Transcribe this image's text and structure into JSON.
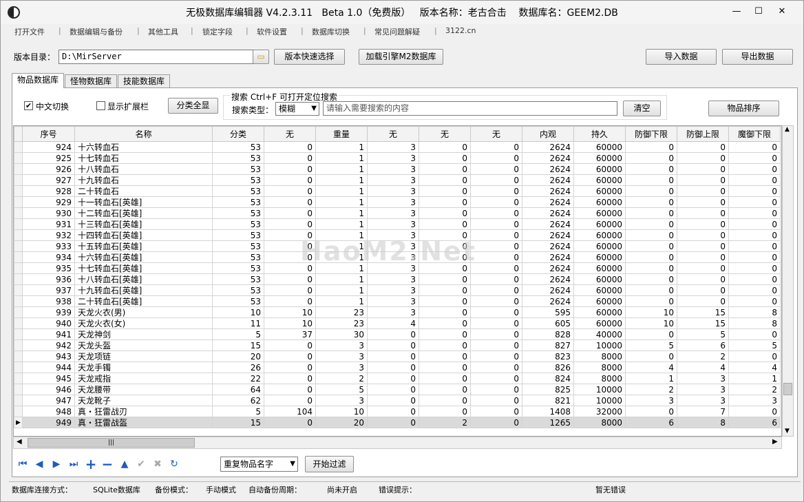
{
  "window": {
    "title": "无极数据库编辑器 V4.2.3.11   Beta 1.0（免费版）   版本名称：老古合击    数据库名：GEEM2.DB",
    "minimize": "—",
    "maximize": "☐",
    "close": "✕"
  },
  "menu": [
    "打开文件",
    "数据编辑与备份",
    "其他工具",
    "锁定字段",
    "软件设置",
    "数据库切换",
    "常见问题解疑",
    "3122.cn"
  ],
  "top": {
    "dir_label": "版本目录：",
    "dir_value": "D:\\MirServer",
    "quick_select": "版本快速选择",
    "load_engine": "加载引擎M2数据库",
    "import": "导入数据",
    "export": "导出数据"
  },
  "tabs": [
    "物品数据库",
    "怪物数据库",
    "技能数据库"
  ],
  "filters": {
    "chinese_switch": "中文切换",
    "chinese_checked": "✔",
    "show_ext": "显示扩展栏",
    "show_all": "分类全显",
    "search_title": "搜索  Ctrl+F 可打开定位搜索",
    "search_type_label": "搜索类型：",
    "search_type_value": "模糊",
    "search_placeholder": "请输入需要搜索的内容",
    "clear": "清空",
    "sort_items": "物品排序"
  },
  "grid": {
    "columns": [
      "序号",
      "名称",
      "分类",
      "无",
      "重量",
      "无",
      "无",
      "无",
      "内观",
      "持久",
      "防御下限",
      "防御上限",
      "魔御下限"
    ],
    "rows": [
      [
        "924",
        "十六转血石",
        "53",
        "0",
        "1",
        "3",
        "0",
        "0",
        "2624",
        "60000",
        "0",
        "0",
        "0"
      ],
      [
        "925",
        "十七转血石",
        "53",
        "0",
        "1",
        "3",
        "0",
        "0",
        "2624",
        "60000",
        "0",
        "0",
        "0"
      ],
      [
        "926",
        "十八转血石",
        "53",
        "0",
        "1",
        "3",
        "0",
        "0",
        "2624",
        "60000",
        "0",
        "0",
        "0"
      ],
      [
        "927",
        "十九转血石",
        "53",
        "0",
        "1",
        "3",
        "0",
        "0",
        "2624",
        "60000",
        "0",
        "0",
        "0"
      ],
      [
        "928",
        "二十转血石",
        "53",
        "0",
        "1",
        "3",
        "0",
        "0",
        "2624",
        "60000",
        "0",
        "0",
        "0"
      ],
      [
        "929",
        "十一转血石[英雄]",
        "53",
        "0",
        "1",
        "3",
        "0",
        "0",
        "2624",
        "60000",
        "0",
        "0",
        "0"
      ],
      [
        "930",
        "十二转血石[英雄]",
        "53",
        "0",
        "1",
        "3",
        "0",
        "0",
        "2624",
        "60000",
        "0",
        "0",
        "0"
      ],
      [
        "931",
        "十三转血石[英雄]",
        "53",
        "0",
        "1",
        "3",
        "0",
        "0",
        "2624",
        "60000",
        "0",
        "0",
        "0"
      ],
      [
        "932",
        "十四转血石[英雄]",
        "53",
        "0",
        "1",
        "3",
        "0",
        "0",
        "2624",
        "60000",
        "0",
        "0",
        "0"
      ],
      [
        "933",
        "十五转血石[英雄]",
        "53",
        "0",
        "1",
        "3",
        "0",
        "0",
        "2624",
        "60000",
        "0",
        "0",
        "0"
      ],
      [
        "934",
        "十六转血石[英雄]",
        "53",
        "0",
        "1",
        "3",
        "0",
        "0",
        "2624",
        "60000",
        "0",
        "0",
        "0"
      ],
      [
        "935",
        "十七转血石[英雄]",
        "53",
        "0",
        "1",
        "3",
        "0",
        "0",
        "2624",
        "60000",
        "0",
        "0",
        "0"
      ],
      [
        "936",
        "十八转血石[英雄]",
        "53",
        "0",
        "1",
        "3",
        "0",
        "0",
        "2624",
        "60000",
        "0",
        "0",
        "0"
      ],
      [
        "937",
        "十九转血石[英雄]",
        "53",
        "0",
        "1",
        "3",
        "0",
        "0",
        "2624",
        "60000",
        "0",
        "0",
        "0"
      ],
      [
        "938",
        "二十转血石[英雄]",
        "53",
        "0",
        "1",
        "3",
        "0",
        "0",
        "2624",
        "60000",
        "0",
        "0",
        "0"
      ],
      [
        "939",
        "天龙火衣(男)",
        "10",
        "10",
        "23",
        "3",
        "0",
        "0",
        "595",
        "60000",
        "10",
        "15",
        "8"
      ],
      [
        "940",
        "天龙火衣(女)",
        "11",
        "10",
        "23",
        "4",
        "0",
        "0",
        "605",
        "60000",
        "10",
        "15",
        "8"
      ],
      [
        "941",
        "天龙神剑",
        "5",
        "37",
        "30",
        "0",
        "0",
        "0",
        "828",
        "40000",
        "0",
        "5",
        "0"
      ],
      [
        "942",
        "天龙头盔",
        "15",
        "0",
        "3",
        "0",
        "0",
        "0",
        "827",
        "10000",
        "5",
        "6",
        "5"
      ],
      [
        "943",
        "天龙项链",
        "20",
        "0",
        "3",
        "0",
        "0",
        "0",
        "823",
        "8000",
        "0",
        "2",
        "0"
      ],
      [
        "944",
        "天龙手镯",
        "26",
        "0",
        "3",
        "0",
        "0",
        "0",
        "826",
        "8000",
        "4",
        "4",
        "4"
      ],
      [
        "945",
        "天龙戒指",
        "22",
        "0",
        "2",
        "0",
        "0",
        "0",
        "824",
        "8000",
        "1",
        "3",
        "1"
      ],
      [
        "946",
        "天龙腰带",
        "64",
        "0",
        "5",
        "0",
        "0",
        "0",
        "825",
        "10000",
        "2",
        "3",
        "2"
      ],
      [
        "947",
        "天龙靴子",
        "62",
        "0",
        "3",
        "0",
        "0",
        "0",
        "821",
        "10000",
        "3",
        "3",
        "3"
      ],
      [
        "948",
        "真・狂雷战刃",
        "5",
        "104",
        "10",
        "0",
        "0",
        "0",
        "1408",
        "32000",
        "0",
        "7",
        "0"
      ],
      [
        "949",
        "真・狂雷战盔",
        "15",
        "0",
        "20",
        "0",
        "2",
        "0",
        "1265",
        "8000",
        "6",
        "8",
        "6"
      ]
    ],
    "selected_index": 25
  },
  "nav": {
    "first": "⏮",
    "prev": "◀",
    "next": "▶",
    "last": "⏭",
    "add": "+",
    "remove": "−",
    "up": "▲",
    "ok": "✔",
    "cancel": "✖",
    "refresh": "↻",
    "filter_select": "重复物品名字",
    "filter_button": "开始过滤"
  },
  "status": {
    "conn_label": "数据库连接方式：",
    "conn_value": "SQLite数据库",
    "backup_label": "备份模式：",
    "backup_value": "手动模式",
    "auto_label": "自动备份周期：",
    "auto_value": "尚未开启",
    "error_label": "错误提示：",
    "error_value": "暂无错误"
  },
  "watermark": "HaoM2.Net"
}
